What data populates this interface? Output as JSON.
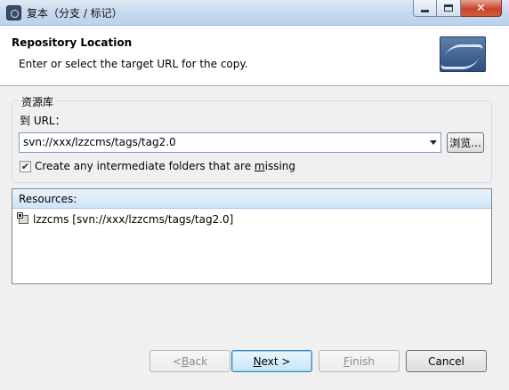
{
  "window": {
    "title": "复本（分支 / 标记）",
    "icon": "subversion-app-icon",
    "controls": [
      "minimize",
      "maximize",
      "close"
    ],
    "close_glyph": "✕"
  },
  "header": {
    "title": "Repository Location",
    "description": "Enter or select the target URL for the copy.",
    "banner_icon": "svn-wizard-banner"
  },
  "repository_group": {
    "legend": "资源库",
    "url_label": "到 URL：",
    "url_value": "svn://xxx/lzzcms/tags/tag2.0",
    "browse_label": "浏览...",
    "create_folders": {
      "checked": true,
      "label_before": "Create any intermediate folders that are ",
      "label_mnemonic": "m",
      "label_after": "issing"
    }
  },
  "resources": {
    "header": "Resources:",
    "items": [
      {
        "label": "lzzcms [svn://xxx/lzzcms/tags/tag2.0]",
        "icon": "project-folder-icon"
      }
    ]
  },
  "buttons": {
    "back": {
      "prefix": "< ",
      "mnemonic": "B",
      "rest": "ack",
      "enabled": false
    },
    "next": {
      "mnemonic": "N",
      "rest": "ext >",
      "enabled": true,
      "default": true
    },
    "finish": {
      "mnemonic": "F",
      "rest": "inish",
      "enabled": false
    },
    "cancel": {
      "label": "Cancel",
      "enabled": true
    }
  }
}
